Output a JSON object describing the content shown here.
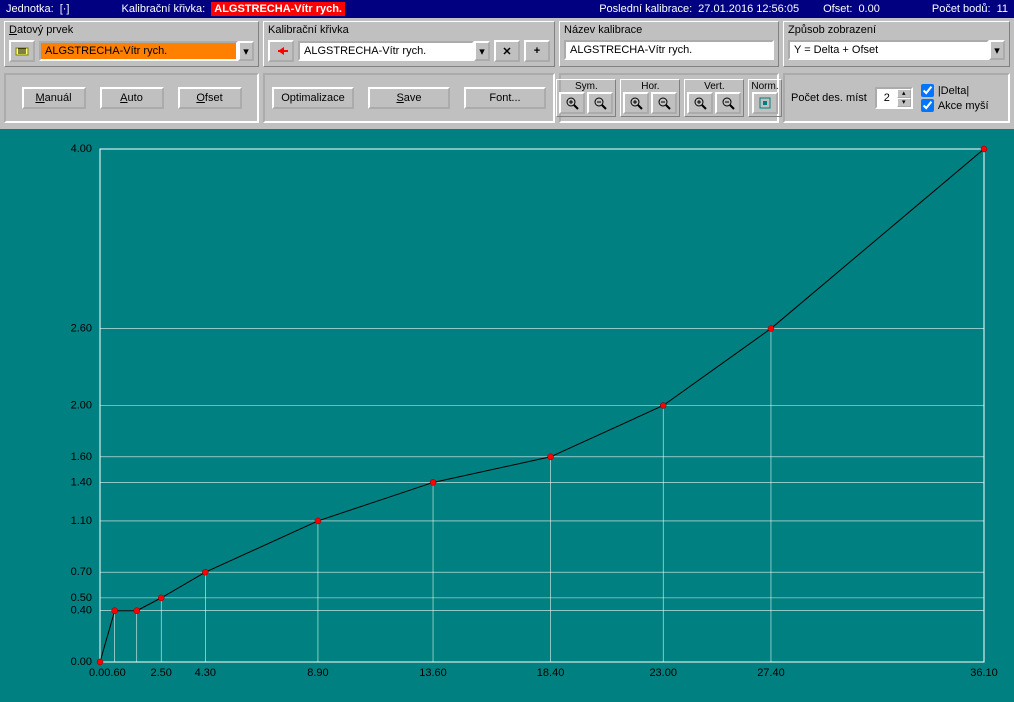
{
  "status": {
    "unit_label": "Jednotka:",
    "unit_value": "[·]",
    "curve_label": "Kalibrační křivka:",
    "curve_value": "ALGSTRECHA-Vítr rych.",
    "lastcal_label": "Poslední kalibrace:",
    "lastcal_value": "27.01.2016 12:56:05",
    "offset_label": "Ofset:",
    "offset_value": "0.00",
    "points_label": "Počet bodů:",
    "points_value": "11"
  },
  "row1": {
    "data_elem_label": "Datový prvek",
    "data_elem_value": "ALGSTRECHA-Vítr rych.",
    "cal_curve_label": "Kalibrační křivka",
    "cal_curve_value": "ALGSTRECHA-Vítr rych.",
    "cal_name_label": "Název kalibrace",
    "cal_name_value": "ALGSTRECHA-Vítr rych.",
    "display_label": "Způsob zobrazení",
    "display_value": "Y = Delta + Ofset"
  },
  "row2": {
    "manual": "Manuál",
    "auto": "Auto",
    "ofset": "Ofset",
    "optim": "Optimalizace",
    "save": "Save",
    "font": "Font...",
    "sym": "Sym.",
    "hor": "Hor.",
    "vert": "Vert.",
    "norm": "Norm.",
    "dec_label": "Počet des. míst",
    "dec_value": "2",
    "chk_delta": "|Delta|",
    "chk_mouse": "Akce myší"
  },
  "chart_data": {
    "type": "line",
    "x": [
      0.0,
      0.6,
      1.5,
      2.5,
      4.3,
      8.9,
      13.6,
      18.4,
      23.0,
      27.4,
      36.1
    ],
    "y": [
      0.0,
      0.4,
      0.4,
      0.5,
      0.7,
      1.1,
      1.4,
      1.6,
      2.0,
      2.6,
      4.0
    ],
    "y_ticks": [
      0.0,
      0.4,
      0.5,
      0.7,
      1.1,
      1.4,
      1.6,
      2.0,
      2.6,
      4.0
    ],
    "x_ticks": [
      0.0,
      0.6,
      2.5,
      4.3,
      8.9,
      13.6,
      18.4,
      23.0,
      27.4,
      36.1
    ],
    "x_tick_labels": [
      "0.00.60",
      "2.50",
      "4.30",
      "8.90",
      "13.60",
      "18.40",
      "23.00",
      "27.40",
      "36.10"
    ],
    "xlabel": "",
    "ylabel": "",
    "title": "",
    "xlim": [
      0,
      36.1
    ],
    "ylim": [
      0,
      4.0
    ]
  }
}
